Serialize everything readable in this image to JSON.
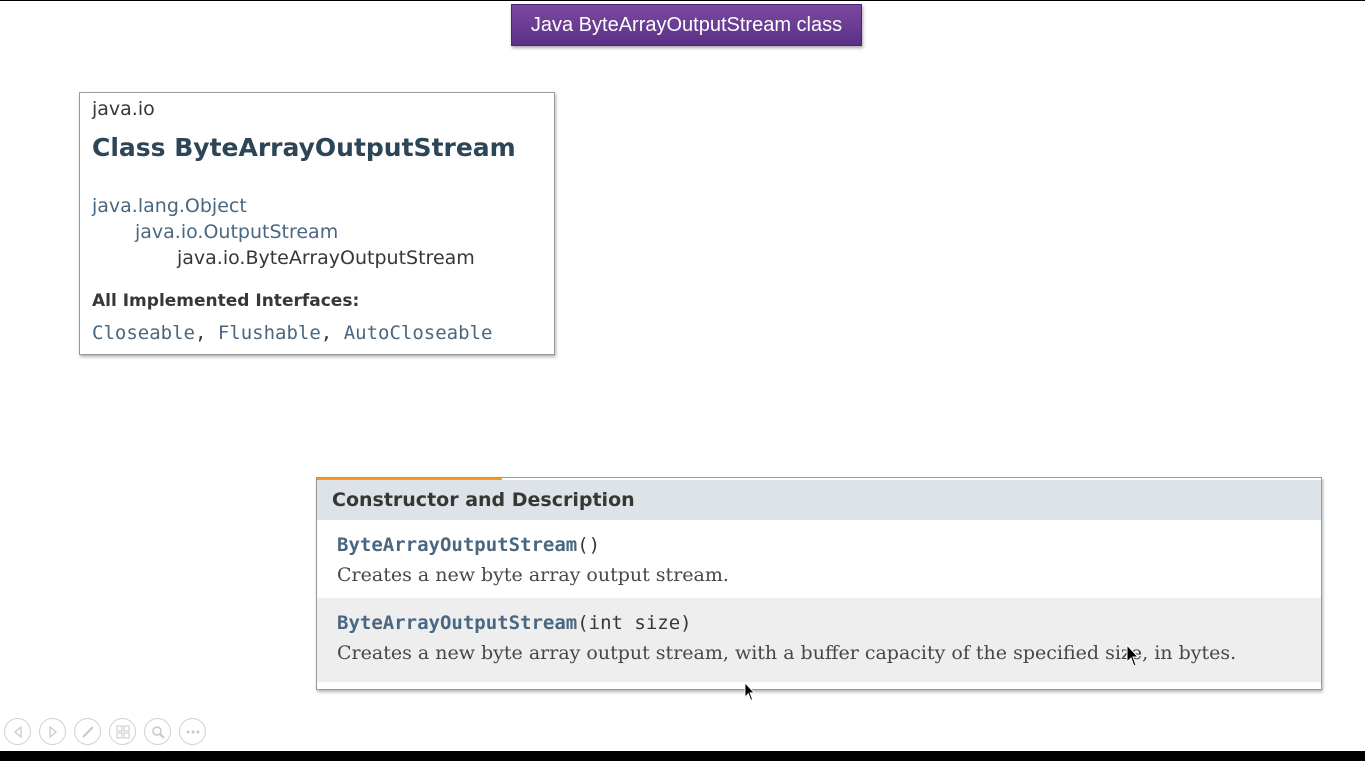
{
  "slide": {
    "title": "Java ByteArrayOutputStream class"
  },
  "class_card": {
    "package": "java.io",
    "title": "Class ByteArrayOutputStream",
    "inheritance": [
      "java.lang.Object",
      "java.io.OutputStream",
      "java.io.ByteArrayOutputStream"
    ],
    "implemented_label": "All Implemented Interfaces:",
    "interfaces": [
      "Closeable",
      "Flushable",
      "AutoCloseable"
    ],
    "interface_sep": ", "
  },
  "constructors": {
    "header": "Constructor and Description",
    "rows": [
      {
        "name": "ByteArrayOutputStream",
        "params": "()",
        "description": "Creates a new byte array output stream."
      },
      {
        "name": "ByteArrayOutputStream",
        "params": "(int size)",
        "description": "Creates a new byte array output stream, with a buffer capacity of the specified size, in bytes."
      }
    ]
  },
  "toolbar": {
    "icons": [
      "previous-icon",
      "next-icon",
      "pen-icon",
      "slides-icon",
      "zoom-icon",
      "more-icon"
    ]
  },
  "colors": {
    "title_bg": "#6a3d93",
    "header_bg": "#dee3e9",
    "link": "#4a6782",
    "accent": "#f8981d"
  }
}
